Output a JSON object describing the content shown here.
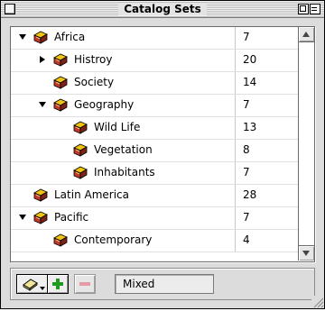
{
  "window": {
    "title": "Catalog Sets"
  },
  "tree": {
    "rows": [
      {
        "label": "Africa",
        "count": "7",
        "level": 0,
        "expander": "expanded"
      },
      {
        "label": "Histroy",
        "count": "20",
        "level": 1,
        "expander": "collapsed"
      },
      {
        "label": "Society",
        "count": "14",
        "level": 1,
        "expander": "none"
      },
      {
        "label": "Geography",
        "count": "7",
        "level": 1,
        "expander": "expanded"
      },
      {
        "label": "Wild Life",
        "count": "13",
        "level": 2,
        "expander": "none"
      },
      {
        "label": "Vegetation",
        "count": "8",
        "level": 2,
        "expander": "none"
      },
      {
        "label": "Inhabitants",
        "count": "7",
        "level": 2,
        "expander": "none"
      },
      {
        "label": "Latin America",
        "count": "28",
        "level": 0,
        "expander": "none"
      },
      {
        "label": "Pacific",
        "count": "7",
        "level": 0,
        "expander": "expanded"
      },
      {
        "label": "Contemporary",
        "count": "4",
        "level": 1,
        "expander": "none"
      }
    ]
  },
  "toolbar": {
    "status_value": "Mixed",
    "icons": [
      "catalog-set-menu-icon",
      "add-icon",
      "remove-icon"
    ]
  },
  "colors": {
    "add_green": "#1f9a1f",
    "remove_pink": "#e59aa8",
    "book_red": "#c0392b",
    "book_yellow": "#f1c40f"
  }
}
